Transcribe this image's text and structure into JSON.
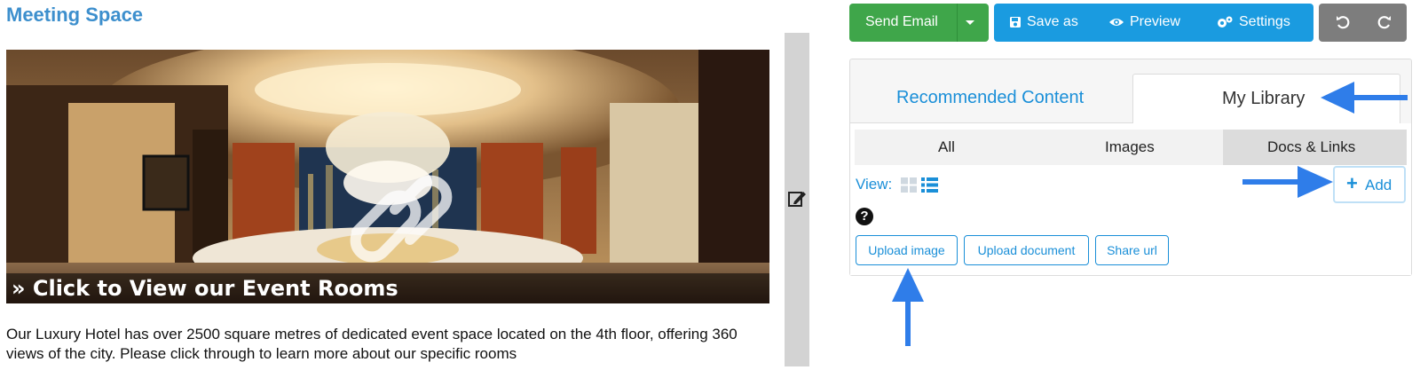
{
  "page_title": "Meeting Space",
  "hero": {
    "caption": "» Click to View our Event Rooms"
  },
  "description": "Our Luxury Hotel has over 2500 square metres of dedicated event space located on the 4th floor, offering 360 views of the city. Please click through to learn more about our specific rooms",
  "toolbar": {
    "send_email": "Send Email",
    "save_as": "Save as",
    "preview": "Preview",
    "settings": "Settings"
  },
  "tabs": {
    "recommended": "Recommended Content",
    "library": "My Library"
  },
  "filters": [
    "All",
    "Images",
    "Docs & Links"
  ],
  "view_label": "View:",
  "add_label": "Add",
  "actions": [
    "Upload image",
    "Upload document",
    "Share url"
  ],
  "colors": {
    "brand_blue": "#1a9be0",
    "send_green": "#3fa64a",
    "title_blue": "#3d8fcd",
    "arrow_blue": "#2f7de9"
  }
}
